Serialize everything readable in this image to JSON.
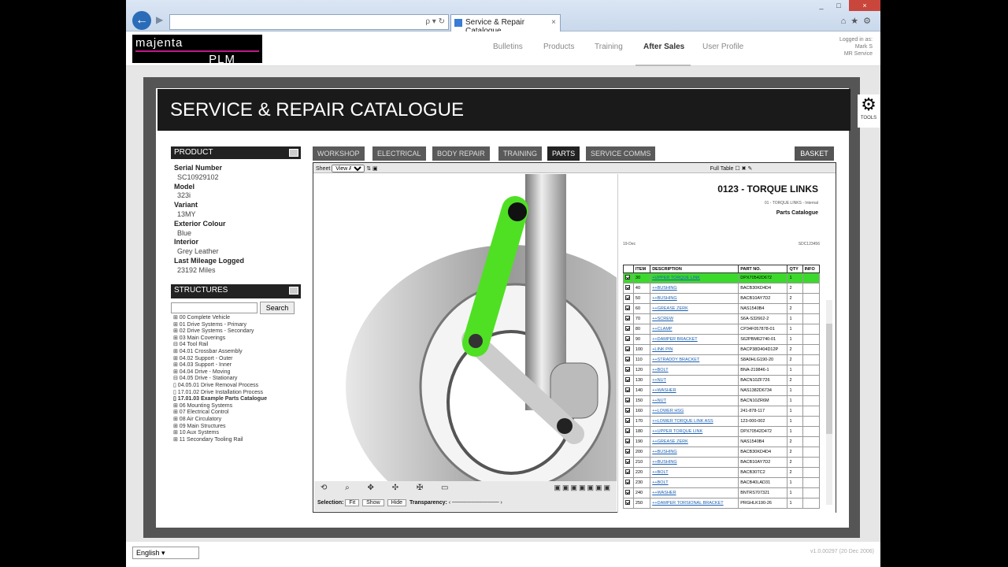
{
  "browser": {
    "address": "",
    "tab_title": "Service & Repair Catalogue",
    "tab_close": "×",
    "back_icon": "arrow-left-icon",
    "window_buttons": [
      "_",
      "□",
      "×"
    ],
    "toolbar_icons": [
      "home-icon",
      "star-icon",
      "gear-icon"
    ],
    "address_controls": "ρ ▾ ↻"
  },
  "logo": {
    "line1": "majenta",
    "line2": "PLM"
  },
  "nav": [
    "Bulletins",
    "Products",
    "Training",
    "After Sales",
    "User Profile"
  ],
  "nav_active": "After Sales",
  "login": {
    "line1": "Logged in as:",
    "line2": "Mark S",
    "line3": "MR Service"
  },
  "page_title": "SERVICE & REPAIR CATALOGUE",
  "tools_label": "TOOLS",
  "product": {
    "header": "PRODUCT",
    "fields": [
      {
        "label": "Serial Number",
        "value": "SC10929102"
      },
      {
        "label": "Model",
        "value": "323i"
      },
      {
        "label": "Variant",
        "value": "13MY"
      },
      {
        "label": "Exterior Colour",
        "value": "Blue"
      },
      {
        "label": "Interior",
        "value": "Grey Leather"
      },
      {
        "label": "Last Mileage Logged",
        "value": "23192 Miles"
      }
    ]
  },
  "structures": {
    "header": "STRUCTURES",
    "search_placeholder": "",
    "search_button": "Search",
    "tree": [
      "⊞ 00 Complete Vehicle",
      "⊞ 01 Drive Systems - Primary",
      "⊞ 02 Drive Systems - Secondary",
      "⊞ 03 Main Coverings",
      "⊟ 04 Tool Rail",
      "   ⊞ 04.01 Crossbar Assembly",
      "   ⊞ 04.02 Support - Outer",
      "   ⊞ 04.03 Support - Inner",
      "   ⊞ 04.04 Drive - Moving",
      "   ⊟ 04.05 Drive - Stationary",
      "      ▯ 04.05.01 Drive Removal Process",
      "      ▯ 17.01.02 Drive Installation Process",
      "      ▯ 17.01.03 Example Parts Catalogue",
      "⊞ 06 Mounting Systems",
      "⊞ 07 Electrical Control",
      "⊞ 08 Air Circulatory",
      "⊞ 09 Main Structures",
      "⊞ 10 Aux Systems",
      "⊞ 11 Secondary Tooling Rail"
    ],
    "selected_index": 12
  },
  "tabs": [
    "WORKSHOP",
    "ELECTRICAL",
    "BODY REPAIR",
    "TRAINING",
    "PARTS",
    "SERVICE COMMS"
  ],
  "tab_active": "PARTS",
  "basket": "BASKET",
  "viewer": {
    "sheet_label": "Sheet",
    "view_value": "View A",
    "full_table": "Full Table",
    "bottom_icons": "⟲ ⌕ ✥ ✣ ✠ ▭",
    "right_icons": "▣▣▣▣▣▣▣",
    "selection_label": "Selection:",
    "fit": "Fit",
    "show": "Show",
    "hide": "Hide",
    "transparency_label": "Transparency:"
  },
  "document": {
    "title": "0123 - TORQUE LINKS",
    "subtitle": "01 - TORQUE LINKS - Internal",
    "catalogue": "Parts Catalogue",
    "left_ref": "19-Dec",
    "right_ref": "SDC123456",
    "headers": [
      "",
      "ITEM",
      "DESCRIPTION",
      "PART NO.",
      "QTY",
      "INFO"
    ],
    "rows": [
      [
        "30",
        "+UPPER TORQUE LINK",
        "DPX70542D672",
        "1"
      ],
      [
        "40",
        "++BUSHING",
        "BACB30KD4D4",
        "2"
      ],
      [
        "50",
        "++BUSHING",
        "BACB10AY7D2",
        "2"
      ],
      [
        "60",
        "++GREASE ZERK",
        "NAS1540B4",
        "2"
      ],
      [
        "70",
        "++SCREW",
        "S6A-S32662-2",
        "1"
      ],
      [
        "80",
        "++CLAMP",
        "CP34F057878-01",
        "1"
      ],
      [
        "90",
        "++DAMPER BRACKET",
        "S62PBM62740-01",
        "1"
      ],
      [
        "100",
        "+LINK PIN",
        "BACP38D404D12P",
        "2"
      ],
      [
        "110",
        "++STRADDY BRACKET",
        "S8A0HLG190-20",
        "2"
      ],
      [
        "120",
        "++BOLT",
        "BNA-219846-1",
        "1"
      ],
      [
        "130",
        "++NUT",
        "BACN10ZF726",
        "2"
      ],
      [
        "140",
        "++WASHER",
        "NAS1382D6734",
        "1"
      ],
      [
        "150",
        "++NUT",
        "BACN10ZR6M",
        "1"
      ],
      [
        "160",
        "++LOWER HSG",
        "241-878-117",
        "1"
      ],
      [
        "170",
        "++LOWER TORQUE LINK ASS",
        "123-000-002",
        "1"
      ],
      [
        "180",
        "++UPPER TORQUE LINK",
        "DPX70542D472",
        "1"
      ],
      [
        "190",
        "++GREASE ZERK",
        "NAS1540B4",
        "2"
      ],
      [
        "200",
        "++BUSHING",
        "BACB30KD4D4",
        "2"
      ],
      [
        "210",
        "++BUSHING",
        "BACB10AY7D2",
        "2"
      ],
      [
        "220",
        "++BOLT",
        "BACB30TC2",
        "2"
      ],
      [
        "230",
        "++BOLT",
        "BACB40LAD31",
        "1"
      ],
      [
        "240",
        "++WASHER",
        "BNTRS707321",
        "1"
      ],
      [
        "250",
        "++DAMPER TORSIONAL BRACKET",
        "PRGHLK190-26",
        "1"
      ]
    ],
    "highlight_row": 0
  },
  "language": "English",
  "version": "v1.0.00297 (20 Dec 2006)"
}
